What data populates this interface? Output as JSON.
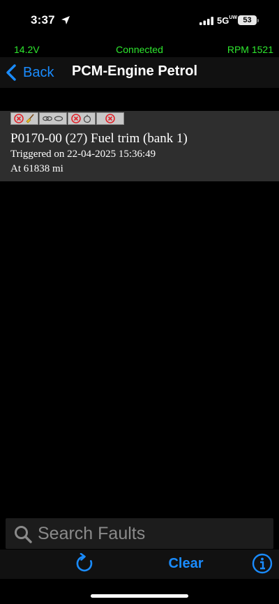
{
  "status_bar": {
    "time": "3:37",
    "network": "5G",
    "network_sub": "UW",
    "battery": "53"
  },
  "telemetry": {
    "voltage": "14.2V",
    "connection": "Connected",
    "rpm": "RPM 1521"
  },
  "nav": {
    "back_label": "Back",
    "title": "PCM-Engine Petrol"
  },
  "faults": [
    {
      "code": "P0170-00 (27) Fuel trim (bank 1)",
      "triggered": "Triggered on 22-04-2025 15:36:49",
      "mileage": "At 61838 mi",
      "badges": [
        "fault-clear-icon",
        "link-icon",
        "fault-timer-icon",
        "fault-icon"
      ]
    }
  ],
  "search": {
    "placeholder": "Search Faults"
  },
  "toolbar": {
    "clear_label": "Clear"
  },
  "colors": {
    "accent": "#1a8cff",
    "ok_green": "#2ee82e",
    "fault_red": "#e0242b",
    "card_bg": "#2e2e2e"
  }
}
